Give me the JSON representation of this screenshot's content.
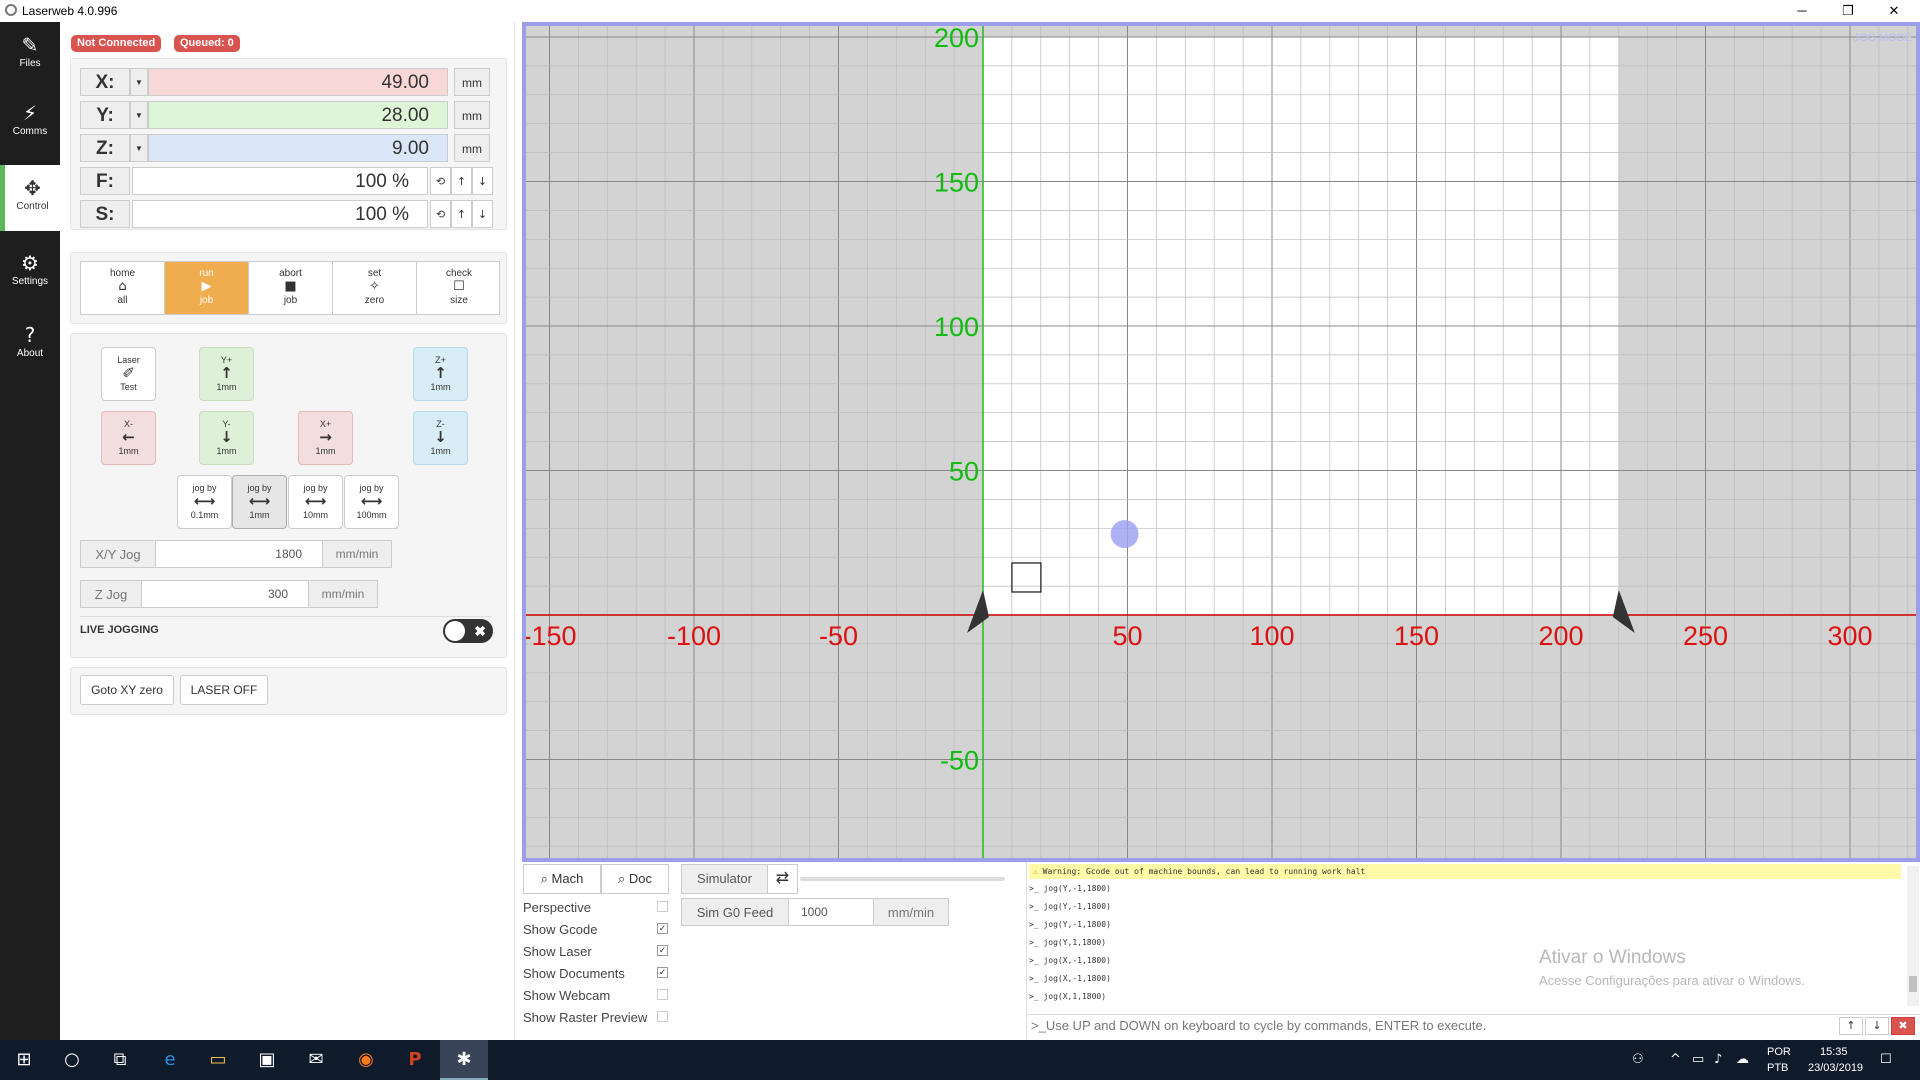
{
  "window": {
    "title": "Laserweb 4.0.996",
    "minimize": "─",
    "restore": "❐",
    "close": "✕"
  },
  "nav": [
    {
      "label": "Files",
      "icon": "edit-icon",
      "glyph": "✎"
    },
    {
      "label": "Comms",
      "icon": "plug-icon",
      "glyph": "⚡"
    },
    {
      "label": "Control",
      "icon": "arrows-icon",
      "glyph": "✥"
    },
    {
      "label": "Settings",
      "icon": "gears-icon",
      "glyph": "⚙"
    },
    {
      "label": "About",
      "icon": "question-icon",
      "glyph": "?"
    }
  ],
  "status": {
    "connection": "Not Connected",
    "queued": "Queued: 0"
  },
  "dro": [
    {
      "axis": "X:",
      "value": "49.00",
      "unit": "mm",
      "color": "#f8d7d7"
    },
    {
      "axis": "Y:",
      "value": "28.00",
      "unit": "mm",
      "color": "#dff5d8"
    },
    {
      "axis": "Z:",
      "value": "9.00",
      "unit": "mm",
      "color": "#dbe6f8"
    }
  ],
  "overrides": [
    {
      "axis": "F:",
      "value": "100 %"
    },
    {
      "axis": "S:",
      "value": "100 %"
    }
  ],
  "override_buttons": {
    "reset": "⟲",
    "up": "↑",
    "down": "↓"
  },
  "run_buttons": [
    {
      "top": "home",
      "glyph": "⌂",
      "bottom": "all"
    },
    {
      "top": "run",
      "glyph": "▶",
      "bottom": "job"
    },
    {
      "top": "abort",
      "glyph": "■",
      "bottom": "job"
    },
    {
      "top": "set",
      "glyph": "✧",
      "bottom": "zero"
    },
    {
      "top": "check",
      "glyph": "☐",
      "bottom": "size"
    }
  ],
  "jog_buttons": {
    "laser": {
      "top": "Laser",
      "glyph": "✐",
      "bottom": "Test"
    },
    "y_plus": {
      "top": "Y+",
      "glyph": "↑",
      "bottom": "1mm"
    },
    "z_plus": {
      "top": "Z+",
      "glyph": "↑",
      "bottom": "1mm"
    },
    "x_minus": {
      "top": "X-",
      "glyph": "←",
      "bottom": "1mm"
    },
    "y_minus": {
      "top": "Y-",
      "glyph": "↓",
      "bottom": "1mm"
    },
    "x_plus": {
      "top": "X+",
      "glyph": "→",
      "bottom": "1mm"
    },
    "z_minus": {
      "top": "Z-",
      "glyph": "↓",
      "bottom": "1mm"
    }
  },
  "jog_steps": [
    {
      "top": "jog by",
      "glyph": "⟷",
      "bottom": "0.1mm"
    },
    {
      "top": "jog by",
      "glyph": "⟷",
      "bottom": "1mm"
    },
    {
      "top": "jog by",
      "glyph": "⟷",
      "bottom": "10mm"
    },
    {
      "top": "jog by",
      "glyph": "⟷",
      "bottom": "100mm"
    }
  ],
  "xy_jog": {
    "label": "X/Y Jog",
    "value": "1800",
    "unit": "mm/min"
  },
  "z_jog": {
    "label": "Z Jog",
    "value": "300",
    "unit": "mm/min"
  },
  "live_jogging": {
    "label": "LIVE JOGGING",
    "toggle_x": "✖"
  },
  "actions": {
    "goto_zero": "Goto XY zero",
    "laser_off": "LASER OFF"
  },
  "canvas": {
    "jog_mode": "JOG MODE",
    "x_ticks": [
      "-150",
      "-100",
      "-50",
      "50",
      "100",
      "150",
      "200",
      "250",
      "300"
    ],
    "y_ticks": [
      "200",
      "150",
      "100",
      "50",
      "-50"
    ],
    "x_tick_values": [
      -150,
      -100,
      -50,
      50,
      100,
      150,
      200,
      250,
      300
    ],
    "y_tick_values": [
      200,
      150,
      100,
      50,
      -50
    ],
    "bed_width": 220,
    "bed_height": 200,
    "laser_position": [
      49,
      28
    ],
    "axis_x_color": "#cc0000",
    "axis_y_color": "#22bb22",
    "label_x_color": "#dd1111",
    "label_y_color": "#11bb11",
    "cursor_color": "#a0a4f2",
    "frame_color": "#9b9fea"
  },
  "view_buttons": {
    "mach": "Mach",
    "doc": "Doc",
    "mach_icon": "⌕",
    "doc_icon": "⌕"
  },
  "simulator": {
    "label": "Simulator",
    "swap_icon": "⇄"
  },
  "sim_feed": {
    "label": "Sim G0 Feed",
    "value": "1000",
    "unit": "mm/min"
  },
  "options": [
    {
      "label": "Perspective",
      "checked": false
    },
    {
      "label": "Show Gcode",
      "checked": true
    },
    {
      "label": "Show Laser",
      "checked": true
    },
    {
      "label": "Show Documents",
      "checked": true
    },
    {
      "label": "Show Webcam",
      "checked": false
    },
    {
      "label": "Show Raster Preview",
      "checked": false
    }
  ],
  "console": {
    "warning": "Warning: Gcode out of machine bounds, can lead to running work halt",
    "warning_icon": "⚠",
    "lines": [
      ">_ jog(Y,-1,1800)",
      ">_ jog(Y,-1,1800)",
      ">_ jog(Y,-1,1800)",
      ">_ jog(Y,1,1800)",
      ">_ jog(X,-1,1800)",
      ">_ jog(X,-1,1800)",
      ">_ jog(X,1,1800)"
    ],
    "command_hint": ">_Use UP and DOWN on keyboard to cycle by commands, ENTER to execute.",
    "up": "↑",
    "down": "↓",
    "clear": "✖"
  },
  "watermark": {
    "line1": "Ativar o Windows",
    "line2": "Acesse Configurações para ativar o Windows."
  },
  "taskbar": {
    "start": "⊞",
    "search": "○",
    "taskview": "⧉",
    "apps": [
      {
        "name": "edge-icon",
        "glyph": "e"
      },
      {
        "name": "explorer-icon",
        "glyph": "▭"
      },
      {
        "name": "store-icon",
        "glyph": "▣"
      },
      {
        "name": "mail-icon",
        "glyph": "✉"
      },
      {
        "name": "firefox-icon",
        "glyph": "◉"
      },
      {
        "name": "powerpoint-icon",
        "glyph": "P"
      },
      {
        "name": "laserweb-icon",
        "glyph": "✱"
      }
    ],
    "tray": {
      "people": "⚇",
      "chevron": "^",
      "network": "▭",
      "volume": "♪",
      "cloud": "☁",
      "lang1": "POR",
      "lang2": "PTB",
      "time": "15:35",
      "date": "23/03/2019",
      "notify": "☐"
    }
  }
}
